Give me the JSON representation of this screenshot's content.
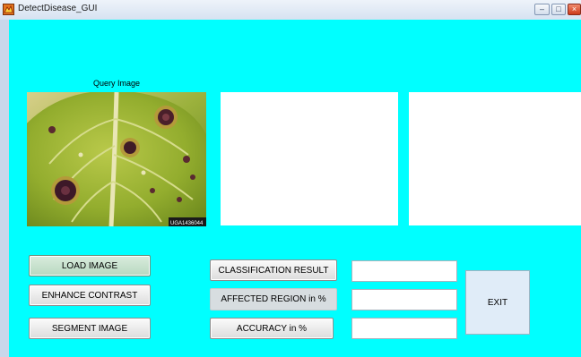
{
  "window": {
    "title": "DetectDisease_GUI",
    "minimize_glyph": "–",
    "maximize_glyph": "□",
    "close_glyph": "×"
  },
  "panel": {
    "query_image_label": "Query Image",
    "image_stamp": "UGA1436044"
  },
  "buttons": {
    "load_image": "LOAD IMAGE",
    "enhance_contrast": "ENHANCE CONTRAST",
    "segment_image": "SEGMENT IMAGE",
    "classification_result": "CLASSIFICATION RESULT",
    "affected_region": "AFFECTED REGION in %",
    "accuracy": "ACCURACY in %",
    "exit": "EXIT"
  },
  "fields": {
    "classification_value": "",
    "affected_region_value": "",
    "accuracy_value": ""
  },
  "colors": {
    "background": "#00ffff",
    "axes": "#ffffff"
  },
  "icons": {
    "app": "matlab-icon"
  }
}
